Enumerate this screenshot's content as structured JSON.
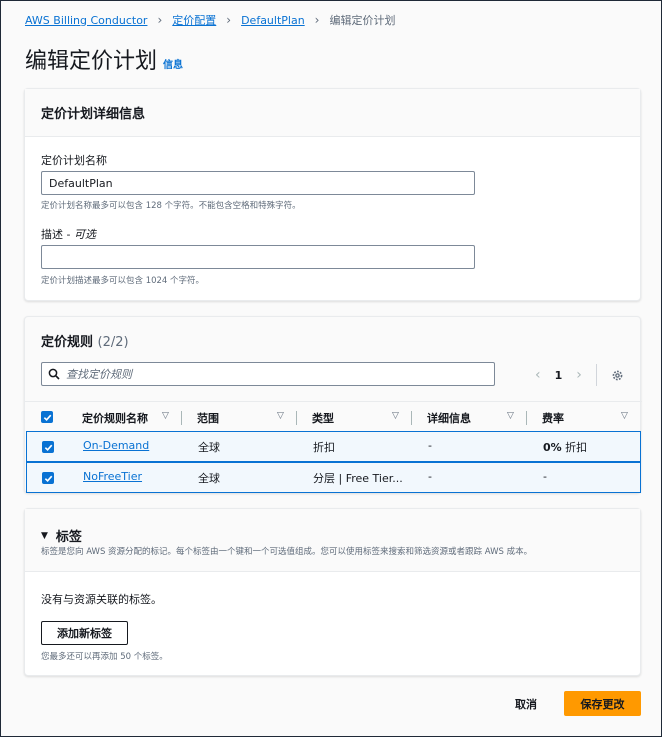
{
  "breadcrumb": {
    "items": [
      "AWS Billing Conductor",
      "定价配置",
      "DefaultPlan"
    ],
    "current": "编辑定价计划"
  },
  "page": {
    "title": "编辑定价计划",
    "info_label": "信息"
  },
  "details": {
    "header": "定价计划详细信息",
    "name_label": "定价计划名称",
    "name_value": "DefaultPlan",
    "name_hint": "定价计划名称最多可以包含 128 个字符。不能包含空格和特殊字符。",
    "desc_label": "描述 - ",
    "desc_optional": "可选",
    "desc_value": "",
    "desc_hint": "定价计划描述最多可以包含 1024 个字符。"
  },
  "rules": {
    "title": "定价规则",
    "count": "(2/2)",
    "search_placeholder": "查找定价规则",
    "current_page": "1",
    "columns": [
      "定价规则名称",
      "范围",
      "类型",
      "详细信息",
      "费率"
    ],
    "rows": [
      {
        "name": "On-Demand",
        "scope": "全球",
        "type": "折扣",
        "details": "-",
        "rate_bold": "0%",
        "rate_rest": " 折扣"
      },
      {
        "name": "NoFreeTier",
        "scope": "全球",
        "type": "分层 | Free Tier...",
        "details": "-",
        "rate_bold": "-",
        "rate_rest": ""
      }
    ]
  },
  "tags": {
    "title": "标签",
    "description": "标签是您向 AWS 资源分配的标记。每个标签由一个键和一个可选值组成。您可以使用标签来搜索和筛选资源或者跟踪 AWS 成本。",
    "empty_text": "没有与资源关联的标签。",
    "add_button": "添加新标签",
    "limit_hint": "您最多还可以再添加 50 个标签。"
  },
  "actions": {
    "cancel": "取消",
    "save": "保存更改"
  },
  "colors": {
    "link": "#0972d3",
    "primary_button": "#ff9900",
    "selected_row_bg": "#f2f8fd"
  }
}
